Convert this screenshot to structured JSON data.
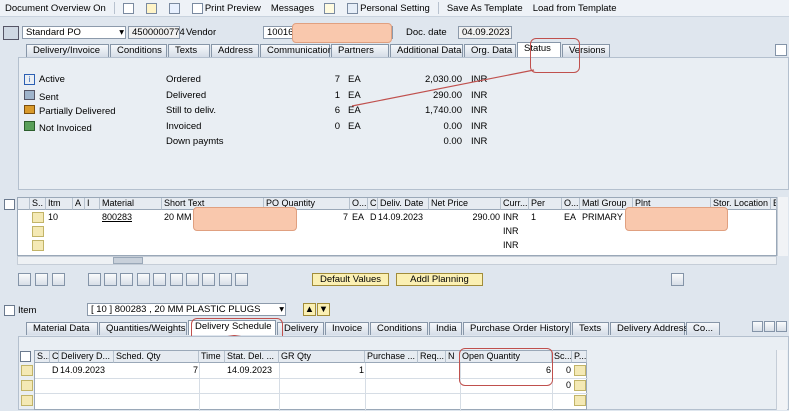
{
  "toolbar": {
    "items": [
      "Document Overview On",
      "Print Preview",
      "Messages",
      "Personal Setting",
      "Save As Template",
      "Load from Template"
    ]
  },
  "header": {
    "doc_type": "Standard PO",
    "po_number": "4500000774",
    "vendor_label": "Vendor",
    "vendor_value": "10016",
    "doc_date_label": "Doc. date",
    "doc_date": "04.09.2023"
  },
  "header_tabs": [
    "Delivery/Invoice",
    "Conditions",
    "Texts",
    "Address",
    "Communication",
    "Partners",
    "Additional Data",
    "Org. Data",
    "Status",
    "Versions"
  ],
  "header_active_tab": "Status",
  "status": {
    "left": [
      "Active",
      "Sent",
      "Partially Delivered",
      "Not Invoiced"
    ],
    "rows": [
      {
        "label": "Ordered",
        "qty": "7",
        "unit": "EA",
        "amount": "2,030.00",
        "curr": "INR"
      },
      {
        "label": "Delivered",
        "qty": "1",
        "unit": "EA",
        "amount": "290.00",
        "curr": "INR"
      },
      {
        "label": "Still to deliv.",
        "qty": "6",
        "unit": "EA",
        "amount": "1,740.00",
        "curr": "INR"
      },
      {
        "label": "Invoiced",
        "qty": "0",
        "unit": "EA",
        "amount": "0.00",
        "curr": "INR"
      },
      {
        "label": "Down paymts",
        "qty": "",
        "unit": "",
        "amount": "0.00",
        "curr": "INR"
      }
    ]
  },
  "items_grid": {
    "headers": [
      "S..",
      "Itm",
      "A",
      "I",
      "Material",
      "Short Text",
      "PO Quantity",
      "O...",
      "C",
      "Deliv. Date",
      "Net Price",
      "Curr...",
      "Per",
      "O...",
      "Matl Group",
      "Plnt",
      "Stor. Location",
      "B"
    ],
    "row": {
      "itm": "10",
      "material": "800283",
      "short_text": "20 MM P",
      "qty": "7",
      "unit": "EA",
      "cat": "D",
      "date": "14.09.2023",
      "price": "290.00",
      "curr": "INR",
      "per": "1",
      "order_unit": "EA",
      "matl_group": "PRIMARY P"
    },
    "extra_curr": [
      "INR",
      "INR"
    ]
  },
  "buttons": {
    "default_values": "Default Values",
    "addl_planning": "Addl Planning"
  },
  "item_detail": {
    "label": "Item",
    "selected": "[ 10 ] 800283 , 20 MM PLASTIC PLUGS"
  },
  "item_tabs": [
    "Material Data",
    "Quantities/Weights",
    "Delivery Schedule",
    "Delivery",
    "Invoice",
    "Conditions",
    "India",
    "Purchase Order History",
    "Texts",
    "Delivery Address",
    "Co..."
  ],
  "item_active_tab": "Delivery Schedule",
  "schedule_grid": {
    "headers": [
      "S...",
      "C",
      "Delivery D...",
      "Sched. Qty",
      "Time",
      "Stat. Del. ...",
      "GR Qty",
      "Purchase ...",
      "Req...",
      "N",
      "Open Quantity",
      "Sc...",
      "P..."
    ],
    "row": {
      "c": "D",
      "date": "14.09.2023",
      "qty": "7",
      "stat": "14.09.2023",
      "gr": "1",
      "open": "6",
      "sc": "0"
    },
    "row2_sc": "0"
  }
}
